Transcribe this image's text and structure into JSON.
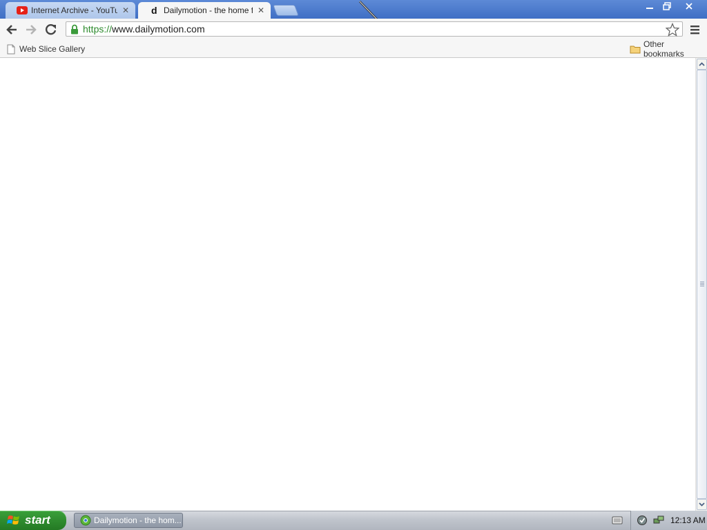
{
  "tabs": [
    {
      "title": "Internet Archive - YouTube",
      "icon": "youtube-icon",
      "active": false
    },
    {
      "title": "Dailymotion - the home for vi",
      "icon": "dailymotion-d-icon",
      "active": true
    }
  ],
  "toolbar": {
    "url_scheme": "https://",
    "url_host": "www.dailymotion.com"
  },
  "bookmarks": {
    "left": "Web Slice Gallery",
    "right": "Other bookmarks"
  },
  "taskbar": {
    "start_label": "start",
    "task_label": "Dailymotion - the hom...",
    "clock": "12:13 AM"
  },
  "colors": {
    "title_bar": "#3f6fc4",
    "secure_green": "#2c8a2c",
    "start_green": "#2f8c2f"
  }
}
